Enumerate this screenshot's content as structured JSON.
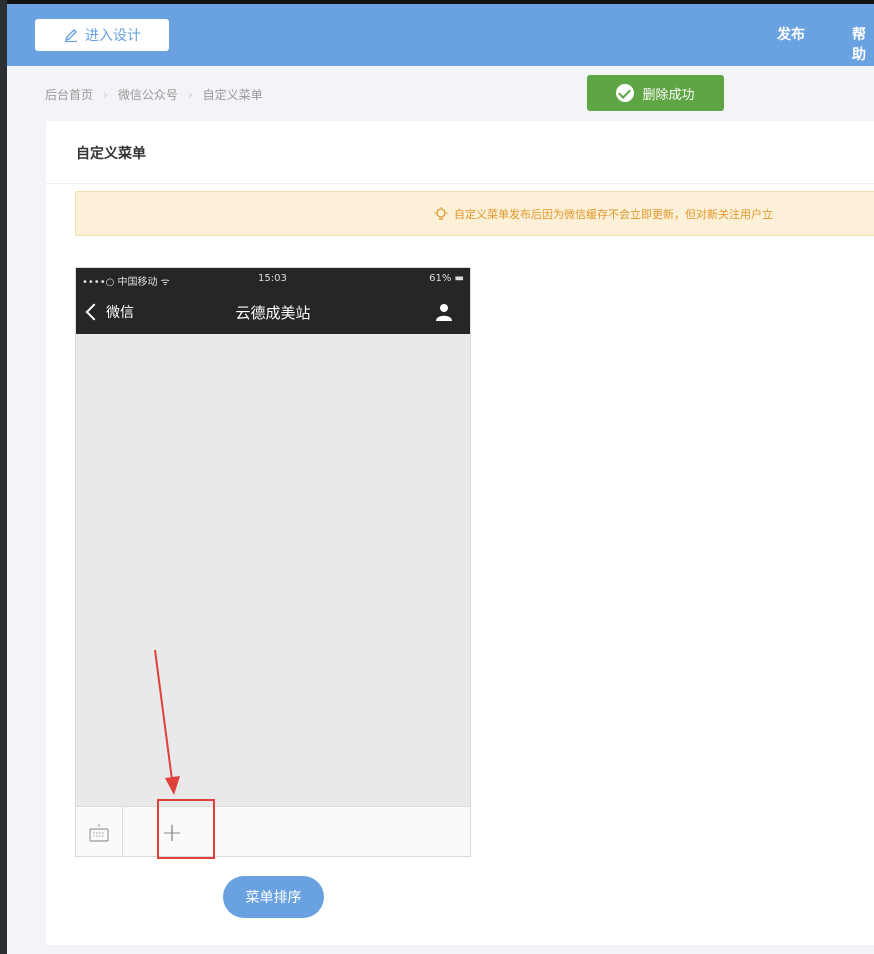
{
  "topbar": {
    "design_button": "进入设计",
    "nav_publish": "发布",
    "nav_help": "帮助"
  },
  "breadcrumb": {
    "items": [
      "后台首页",
      "微信公众号",
      "自定义菜单"
    ]
  },
  "toast": {
    "text": "删除成功"
  },
  "panel": {
    "title": "自定义菜单"
  },
  "notice": {
    "text": "自定义菜单发布后因为微信缓存不会立即更新，但对新关注用户立"
  },
  "phone": {
    "carrier": "••••○ 中国移动 ᯤ",
    "time": "15:03",
    "battery": "61% ▬",
    "back_label": "微信",
    "title": "云德成美站"
  },
  "menu_bar": {
    "add_symbol": "+"
  },
  "sort_button": "菜单排序",
  "colors": {
    "topbar": "#6aa2e1",
    "toast": "#5ea544",
    "highlight": "#e0403a",
    "notice_bg": "#fcf1d8"
  }
}
